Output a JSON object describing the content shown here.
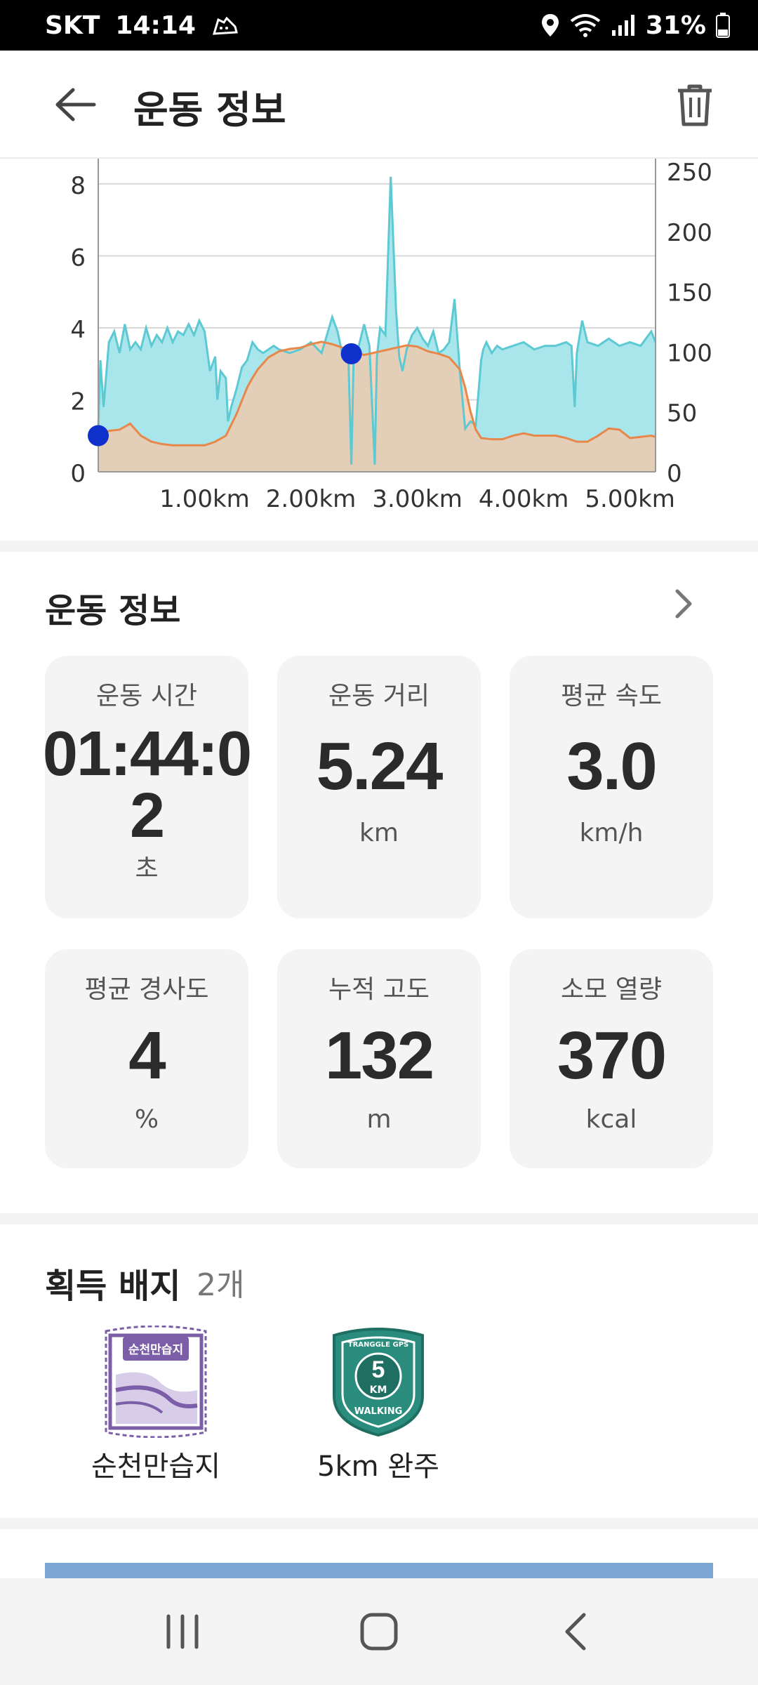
{
  "status_bar": {
    "carrier": "SKT",
    "time": "14:14",
    "battery": "31%"
  },
  "header": {
    "title": "운동 정보"
  },
  "chart_data": {
    "type": "area",
    "left_axis": {
      "ticks": [
        "0",
        "2",
        "4",
        "6",
        "8"
      ],
      "ylim": [
        0,
        8.7
      ]
    },
    "right_axis": {
      "ticks": [
        "0",
        "50",
        "100",
        "150",
        "200",
        "250"
      ],
      "ylim": [
        0,
        260
      ]
    },
    "x_ticks": [
      "1.00km",
      "2.00km",
      "3.00km",
      "4.00km",
      "5.00km"
    ],
    "x_tick_values": [
      1.0,
      2.0,
      3.0,
      4.0,
      5.0
    ],
    "xlim": [
      0,
      5.24
    ],
    "grid": true,
    "colors": {
      "speed": "#5cc9d3",
      "speed_fill": "#a9e6ec",
      "elevation": "#e8874a",
      "elevation_fill": "#f7c6a6",
      "overlap_fill": "#c7c0a4",
      "marker": "#1030cc"
    },
    "series": [
      {
        "axis": "left",
        "x": [
          0,
          0.02,
          0.05,
          0.1,
          0.15,
          0.2,
          0.25,
          0.3,
          0.35,
          0.4,
          0.45,
          0.5,
          0.55,
          0.6,
          0.65,
          0.7,
          0.75,
          0.8,
          0.85,
          0.9,
          0.95,
          1.0,
          1.05,
          1.1,
          1.12,
          1.15,
          1.2,
          1.22,
          1.25,
          1.3,
          1.35,
          1.4,
          1.45,
          1.5,
          1.55,
          1.6,
          1.65,
          1.7,
          1.8,
          1.9,
          2.0,
          2.1,
          2.2,
          2.25,
          2.3,
          2.35,
          2.38,
          2.4,
          2.45,
          2.5,
          2.55,
          2.6,
          2.62,
          2.65,
          2.7,
          2.75,
          2.8,
          2.83,
          2.86,
          2.9,
          2.95,
          3.0,
          3.05,
          3.1,
          3.15,
          3.2,
          3.25,
          3.3,
          3.35,
          3.4,
          3.45,
          3.5,
          3.55,
          3.6,
          3.62,
          3.65,
          3.7,
          3.75,
          3.8,
          3.9,
          4.0,
          4.1,
          4.2,
          4.3,
          4.4,
          4.45,
          4.48,
          4.5,
          4.55,
          4.6,
          4.7,
          4.8,
          4.9,
          5.0,
          5.1,
          5.2,
          5.24
        ],
        "values": [
          1.2,
          3.1,
          1.8,
          3.6,
          3.9,
          3.3,
          4.1,
          3.4,
          3.6,
          3.4,
          4.0,
          3.5,
          3.8,
          3.6,
          4.0,
          3.6,
          3.9,
          3.8,
          4.1,
          3.8,
          4.2,
          3.9,
          2.8,
          3.2,
          2.0,
          2.8,
          2.6,
          1.4,
          1.8,
          2.3,
          2.9,
          3.1,
          3.6,
          3.4,
          3.3,
          3.4,
          3.5,
          3.4,
          3.3,
          3.4,
          3.6,
          3.3,
          4.3,
          3.9,
          3.2,
          3.4,
          0.2,
          3.0,
          3.5,
          4.1,
          3.5,
          0.2,
          3.2,
          4.0,
          3.8,
          8.2,
          4.5,
          3.2,
          2.8,
          3.4,
          3.8,
          4.0,
          3.7,
          3.5,
          3.9,
          3.3,
          3.4,
          3.6,
          4.8,
          2.8,
          1.2,
          1.4,
          1.3,
          3.1,
          3.4,
          3.6,
          3.3,
          3.5,
          3.4,
          3.5,
          3.6,
          3.4,
          3.5,
          3.5,
          3.6,
          3.5,
          1.8,
          3.3,
          4.2,
          3.6,
          3.5,
          3.7,
          3.5,
          3.6,
          3.5,
          3.9,
          3.6
        ]
      },
      {
        "axis": "right",
        "x": [
          0,
          0.1,
          0.2,
          0.3,
          0.4,
          0.5,
          0.6,
          0.7,
          0.8,
          0.9,
          1.0,
          1.1,
          1.2,
          1.3,
          1.4,
          1.45,
          1.5,
          1.6,
          1.7,
          1.8,
          1.9,
          2.0,
          2.1,
          2.2,
          2.3,
          2.4,
          2.5,
          2.6,
          2.7,
          2.8,
          2.9,
          3.0,
          3.1,
          3.2,
          3.3,
          3.4,
          3.45,
          3.5,
          3.55,
          3.6,
          3.7,
          3.8,
          3.9,
          4.0,
          4.1,
          4.2,
          4.3,
          4.4,
          4.5,
          4.6,
          4.7,
          4.8,
          4.9,
          5.0,
          5.1,
          5.2,
          5.24
        ],
        "values": [
          30,
          34,
          35,
          40,
          30,
          25,
          23,
          22,
          22,
          22,
          22,
          25,
          30,
          48,
          70,
          78,
          85,
          95,
          100,
          102,
          103,
          106,
          108,
          106,
          103,
          100,
          97,
          99,
          101,
          103,
          105,
          104,
          100,
          98,
          95,
          85,
          70,
          50,
          35,
          28,
          27,
          27,
          30,
          32,
          30,
          30,
          30,
          28,
          25,
          25,
          30,
          36,
          35,
          28,
          29,
          30,
          29
        ]
      }
    ],
    "markers": [
      {
        "x": 0.0,
        "y": 30
      },
      {
        "x": 2.38,
        "y": 98
      }
    ]
  },
  "workout_section": {
    "title": "운동 정보",
    "cards": [
      {
        "label": "운동 시간",
        "value_line1": "01:44:0",
        "value_line2": "2",
        "unit": "초"
      },
      {
        "label": "운동 거리",
        "value": "5.24",
        "unit": "km"
      },
      {
        "label": "평균 속도",
        "value": "3.0",
        "unit": "km/h"
      },
      {
        "label": "평균 경사도",
        "value": "4",
        "unit": "%"
      },
      {
        "label": "누적 고도",
        "value": "132",
        "unit": "m"
      },
      {
        "label": "소모 열량",
        "value": "370",
        "unit": "kcal"
      }
    ]
  },
  "badges_section": {
    "title": "획득 배지",
    "count": "2개",
    "items": [
      {
        "label": "순천만습지",
        "badge_text": "순천만습지",
        "color": "#7b5ea7"
      },
      {
        "label": "5km 완주",
        "badge_top": "TRANGGLE GPS",
        "badge_num": "5",
        "badge_sub": "KM",
        "badge_bottom": "WALKING",
        "color": "#2a8c7c"
      }
    ]
  }
}
